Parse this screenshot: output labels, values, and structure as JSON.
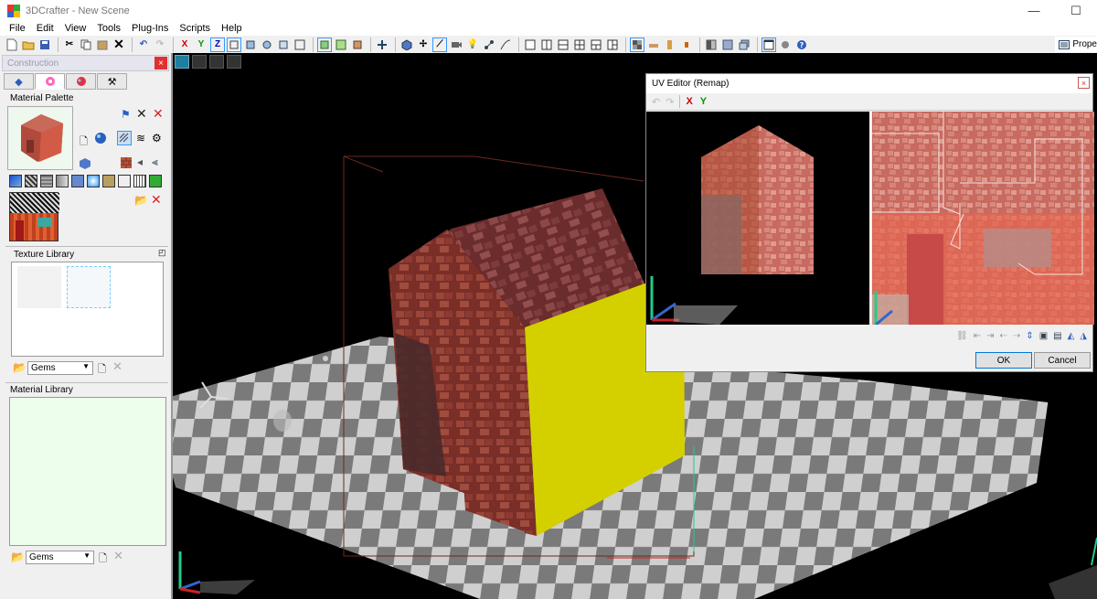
{
  "window": {
    "title": "3DCrafter - New Scene",
    "minimize": "—",
    "maximize": "☐"
  },
  "menu": [
    "File",
    "Edit",
    "View",
    "Tools",
    "Plug-Ins",
    "Scripts",
    "Help"
  ],
  "toolbar": {
    "axis_x": "X",
    "axis_y": "Y",
    "axis_z": "Z",
    "properties_label": "Prope"
  },
  "construction_panel": {
    "title": "Construction",
    "close": "×",
    "material_palette_label": "Material Palette",
    "texture_library_label": "Texture Library",
    "texture_library_dropdown": "Gems",
    "material_library_label": "Material Library",
    "material_library_dropdown": "Gems"
  },
  "uv_editor": {
    "title": "UV Editor (Remap)",
    "close": "×",
    "axis_x": "X",
    "axis_y": "Y",
    "ok_label": "OK",
    "cancel_label": "Cancel"
  },
  "colors": {
    "accent_blue": "#0078d7",
    "close_red": "#e03030",
    "wall_yellow": "#d4d000",
    "brick_red": "#8a3a2e",
    "map_background": "#e4685a"
  }
}
